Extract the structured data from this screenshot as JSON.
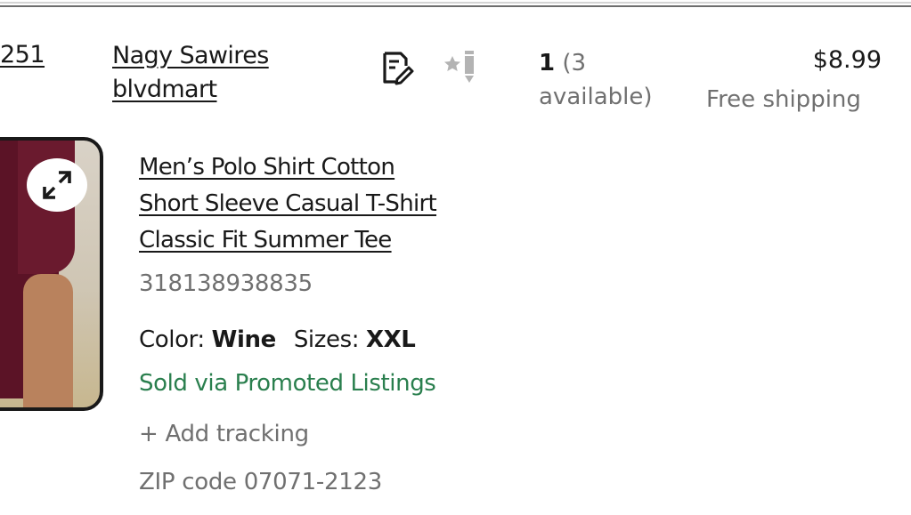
{
  "order": {
    "order_number_fragment": "251",
    "buyer": {
      "name": "Nagy Sawires",
      "username": "blvdmart"
    },
    "quantity": {
      "sold": "1",
      "available": "(3 available)"
    },
    "price": "$8.99",
    "shipping": "Free shipping"
  },
  "item": {
    "title_lines": [
      "Men’s Polo Shirt Cotton",
      "Short Sleeve Casual T-Shirt",
      "Classic Fit Summer Tee"
    ],
    "item_number": "318138938835",
    "variation": {
      "color_label": "Color:",
      "color_value": "Wine",
      "size_label": "Sizes:",
      "size_value": "XXL"
    },
    "promoted_label": "Sold via Promoted Listings",
    "add_tracking_label": "+ Add tracking",
    "zip_label": "ZIP code 07071-2123"
  },
  "icons": {
    "note": "note-edit-icon",
    "feedback": "leave-feedback-icon",
    "expand": "expand-image-icon"
  },
  "colors": {
    "promoted": "#2a7f4e",
    "secondary_text": "#707070",
    "primary_text": "#191919",
    "shirt": "#5b1326"
  }
}
